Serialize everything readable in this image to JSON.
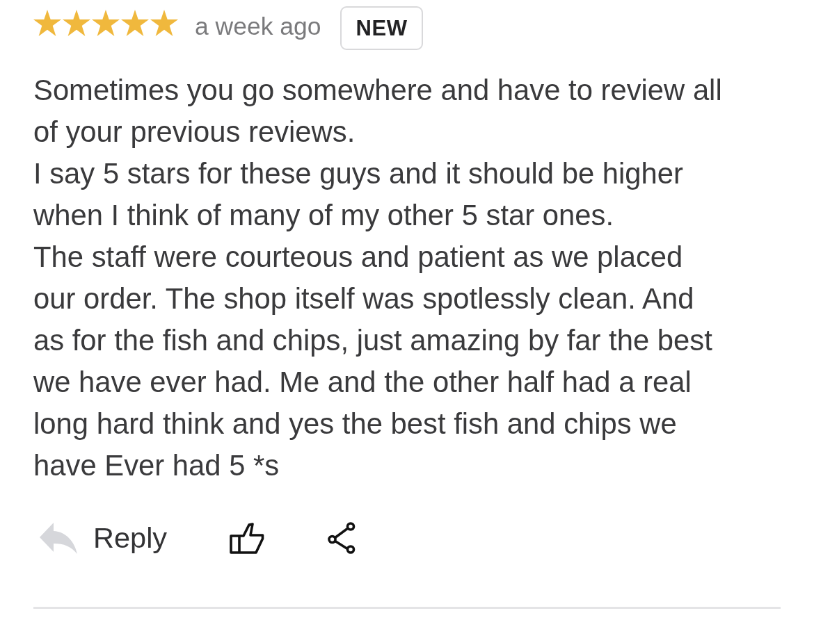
{
  "review": {
    "stars": 5,
    "time": "a week ago",
    "badge": "NEW",
    "paragraphs": [
      "Sometimes you go somewhere and have to review all of your previous reviews.",
      "I say 5 stars for these guys and it should be higher when I think of many of my other 5 star ones.",
      "The staff were courteous and patient as we placed our order. The shop itself was spotlessly clean. And as for the fish and chips, just amazing by far the best we have ever had. Me and the other half had a real long hard think and yes the best fish and chips we have Ever had 5 *s"
    ]
  },
  "actions": {
    "reply": "Reply"
  }
}
